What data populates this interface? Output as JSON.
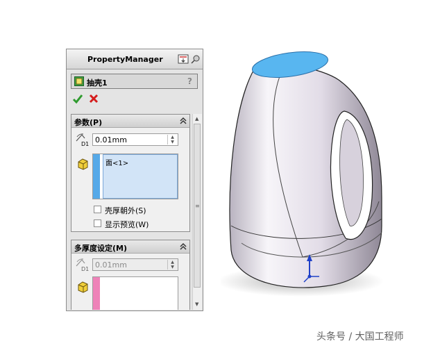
{
  "property_manager": {
    "title": "PropertyManager",
    "header_icons": [
      "pin-icon",
      "expand-icon"
    ],
    "feature": {
      "title": "抽壳1",
      "help": "?"
    },
    "actions": {
      "ok_icon": "checkmark-icon",
      "cancel_icon": "close-icon",
      "ok_color": "#2f9b2f",
      "cancel_color": "#d41c1c"
    },
    "params_group": {
      "title": "参数(P)",
      "thickness_label": "D1",
      "thickness_value": "0.01mm",
      "faces": [
        "面<1>"
      ],
      "thick_out_label": "壳厚朝外(S)",
      "thick_out_checked": false,
      "preview_label": "显示预览(W)",
      "preview_checked": false
    },
    "multi_group": {
      "title": "多厚度设定(M)",
      "thickness_label": "D1",
      "thickness_value": "0.01mm"
    }
  },
  "model": {
    "body_color": "#dcd6e2",
    "top_face_color": "#58b6f0",
    "triad_color": "#1f40c8"
  },
  "watermark": "头条号 / 大国工程师"
}
